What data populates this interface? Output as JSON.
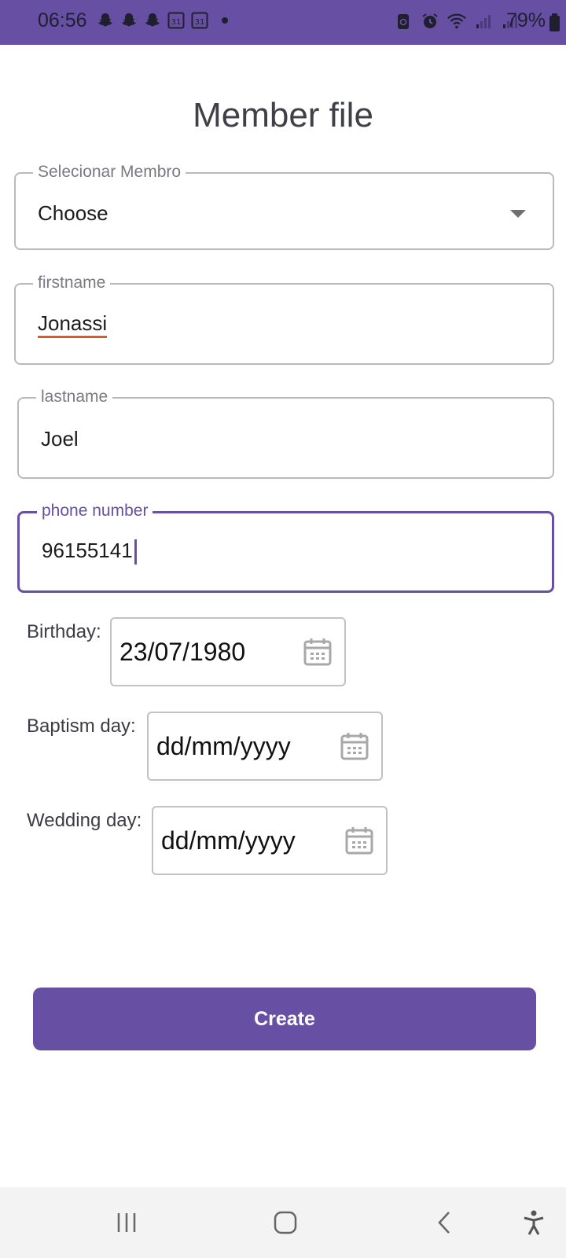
{
  "status_bar": {
    "time": "06:56",
    "battery": "79%",
    "background_color": "#6750a4",
    "notification_icons": [
      "snapchat-icon",
      "snapchat-icon",
      "snapchat-icon",
      "calendar-31-icon",
      "calendar-31-icon"
    ],
    "calendar_day": "31",
    "system_icons": [
      "recycle-icon",
      "alarm-icon",
      "wifi-icon",
      "signal-icon",
      "signal-icon"
    ]
  },
  "page": {
    "title": "Member file"
  },
  "form": {
    "member_select": {
      "label": "Selecionar Membro",
      "value": "Choose"
    },
    "firstname": {
      "label": "firstname",
      "value": "Jonassi"
    },
    "lastname": {
      "label": "lastname",
      "value": "Joel"
    },
    "phone": {
      "label": "phone number",
      "value": "96155141"
    },
    "birthday": {
      "label": "Birthday:",
      "value": "23/07/1980"
    },
    "baptism": {
      "label": "Baptism day:",
      "value": "dd/mm/yyyy"
    },
    "wedding": {
      "label": "Wedding day:",
      "value": "dd/mm/yyyy"
    },
    "submit_label": "Create"
  },
  "colors": {
    "accent": "#6750a4",
    "spellcheck_underline": "#e2582a"
  },
  "nav_bar": {
    "buttons": [
      "recent-apps-icon",
      "home-icon",
      "back-icon",
      "accessibility-icon"
    ]
  }
}
